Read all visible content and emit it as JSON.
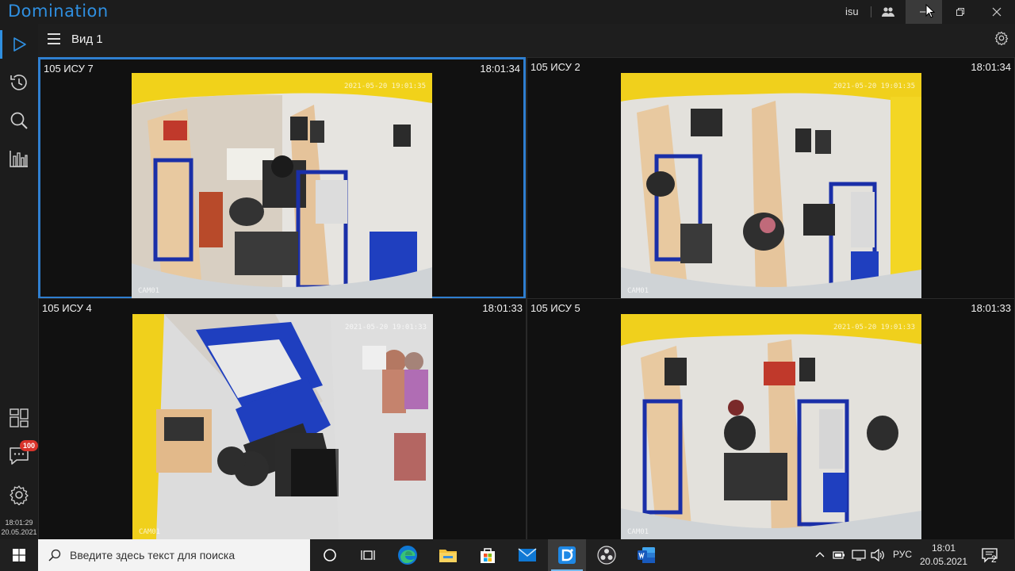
{
  "app": {
    "title": "Domination",
    "user": "isu"
  },
  "toolbar": {
    "view_title": "Вид 1"
  },
  "sidebar": {
    "badge_count": "100",
    "time": "18:01:29",
    "date": "20.05.2021"
  },
  "cameras": [
    {
      "name": "105 ИСУ 7",
      "time": "18:01:34",
      "osd": "2021-05-20 19:01:35",
      "cam": "CAM01"
    },
    {
      "name": "105 ИСУ 2",
      "time": "18:01:34",
      "osd": "2021-05-20 19:01:35",
      "cam": "CAM01"
    },
    {
      "name": "105 ИСУ 4",
      "time": "18:01:33",
      "osd": "2021-05-20 19:01:33",
      "cam": "CAM01"
    },
    {
      "name": "105 ИСУ 5",
      "time": "18:01:33",
      "osd": "2021-05-20 19:01:33",
      "cam": "CAM01"
    }
  ],
  "taskbar": {
    "search_placeholder": "Введите здесь текст для поиска",
    "lang": "РУС",
    "time": "18:01",
    "date": "20.05.2021",
    "notifications": "2"
  },
  "colors": {
    "accent": "#2f8fe0",
    "selected_border": "#2f7fd0",
    "badge": "#d9342b"
  }
}
